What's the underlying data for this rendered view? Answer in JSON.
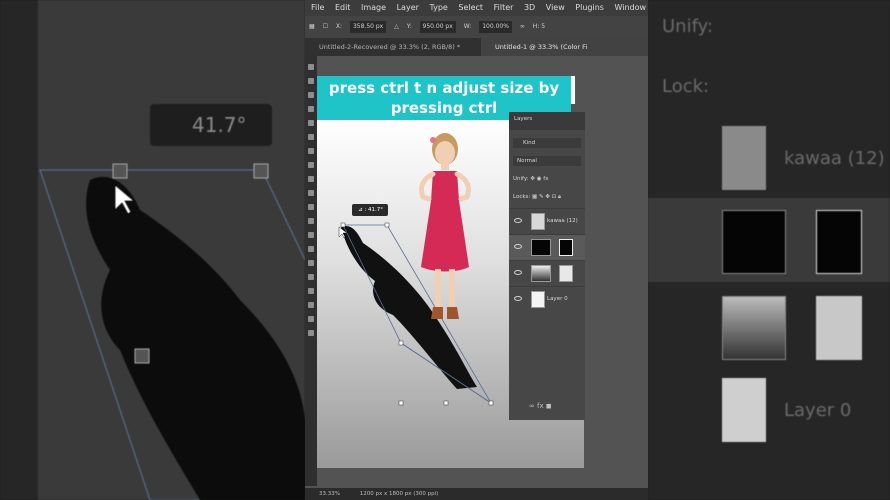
{
  "menu": [
    "File",
    "Edit",
    "Image",
    "Layer",
    "Type",
    "Select",
    "Filter",
    "3D",
    "View",
    "Plugins",
    "Window"
  ],
  "options": {
    "x_label": "X:",
    "x_value": "358.50 px",
    "y_label": "Y:",
    "y_value": "950.00 px",
    "w_label": "W:",
    "w_value": "100.00%",
    "h_label": "H: 5"
  },
  "tabs": [
    {
      "label": "Untitled-2-Recovered @ 33.3% (2, RGB/8) *",
      "active": false
    },
    {
      "label": "Untitled-1 @ 33.3% (Color Fi",
      "active": true
    }
  ],
  "caption": "press ctrl t n adjust size by pressing ctrl",
  "angle_readout": "41.7°",
  "layers_panel": {
    "title": "Layers",
    "kind_placeholder": "Kind",
    "blend_mode": "Normal",
    "unify_label": "Unify:",
    "lock_label": "Locks:",
    "layers": [
      {
        "name": "kawaa (12)",
        "thumb": "image"
      },
      {
        "name": "",
        "thumb": "black-with-mask"
      },
      {
        "name": "",
        "thumb": "gradient-with-mask"
      },
      {
        "name": "Layer 0",
        "thumb": "white"
      }
    ],
    "footer": "∞ fx ◼"
  },
  "status": {
    "zoom": "33.33%",
    "doc_info": "1200 px x 1800 px (300 ppi)"
  },
  "background": {
    "angle_readout": "41.7°",
    "unify_label": "Unify:",
    "lock_label": "Lock:",
    "layer1": "kawaa (12)",
    "layer4": "Layer 0"
  },
  "colors": {
    "caption_bg": "#1ec4c8",
    "dress": "#d42a55"
  }
}
